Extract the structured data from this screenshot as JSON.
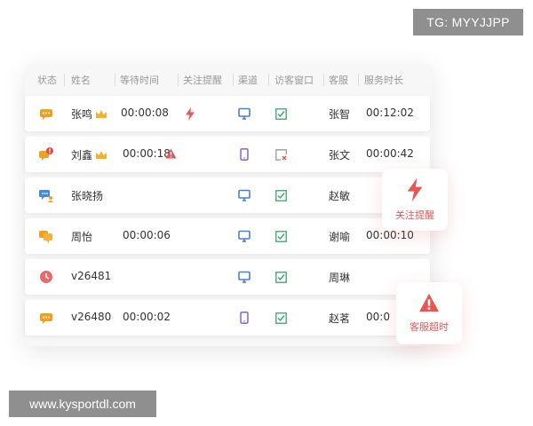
{
  "watermarks": {
    "top": "TG: MYYJJPP",
    "bottom": "www.kysportdl.com"
  },
  "table": {
    "headers": [
      "状态",
      "姓名",
      "等待时间",
      "关注提醒",
      "渠道",
      "访客窗口",
      "客服",
      "服务时长"
    ],
    "rows": [
      {
        "status": "chat",
        "status_color": "#f0a020",
        "name": "张鸣",
        "crown": true,
        "wait": "00:00:08",
        "alert": "bolt",
        "channel": "desktop",
        "window": "ok",
        "agent": "张智",
        "duration": "00:12:02"
      },
      {
        "status": "chat-alert",
        "status_color": "#f0a020",
        "name": "刘鑫",
        "crown": true,
        "wait": "00:00:18",
        "alert": "warning",
        "channel": "mobile",
        "window": "closed",
        "agent": "张文",
        "duration": "00:00:42"
      },
      {
        "status": "transfer",
        "status_color": "#4a8ad4",
        "name": "张晓扬",
        "crown": false,
        "wait": "",
        "alert": "",
        "channel": "desktop",
        "window": "ok",
        "agent": "赵敏",
        "duration": ""
      },
      {
        "status": "chat-double",
        "status_color": "#f0a020",
        "name": "周怡",
        "crown": false,
        "wait": "00:00:06",
        "alert": "",
        "channel": "desktop",
        "window": "ok",
        "agent": "谢喻",
        "duration": "00:00:10"
      },
      {
        "status": "clock",
        "status_color": "#e86a6a",
        "name": "v26481",
        "crown": false,
        "wait": "",
        "alert": "",
        "channel": "desktop",
        "window": "ok",
        "agent": "周琳",
        "duration": ""
      },
      {
        "status": "chat",
        "status_color": "#f0a020",
        "name": "v26480",
        "crown": false,
        "wait": "00:00:02",
        "alert": "",
        "channel": "mobile",
        "window": "ok",
        "agent": "赵茗",
        "duration": "00:0"
      }
    ]
  },
  "floating_cards": [
    {
      "label": "关注提醒",
      "icon": "bolt-icon",
      "color": "#e85555"
    },
    {
      "label": "客服超时",
      "icon": "warning-icon",
      "color": "#e85555"
    }
  ],
  "colors": {
    "desktop": "#4a7fd0",
    "mobile": "#8a6ed6",
    "window_ok": "#3aa36b",
    "window_closed": "#e05555",
    "crown": "#f2b424"
  }
}
